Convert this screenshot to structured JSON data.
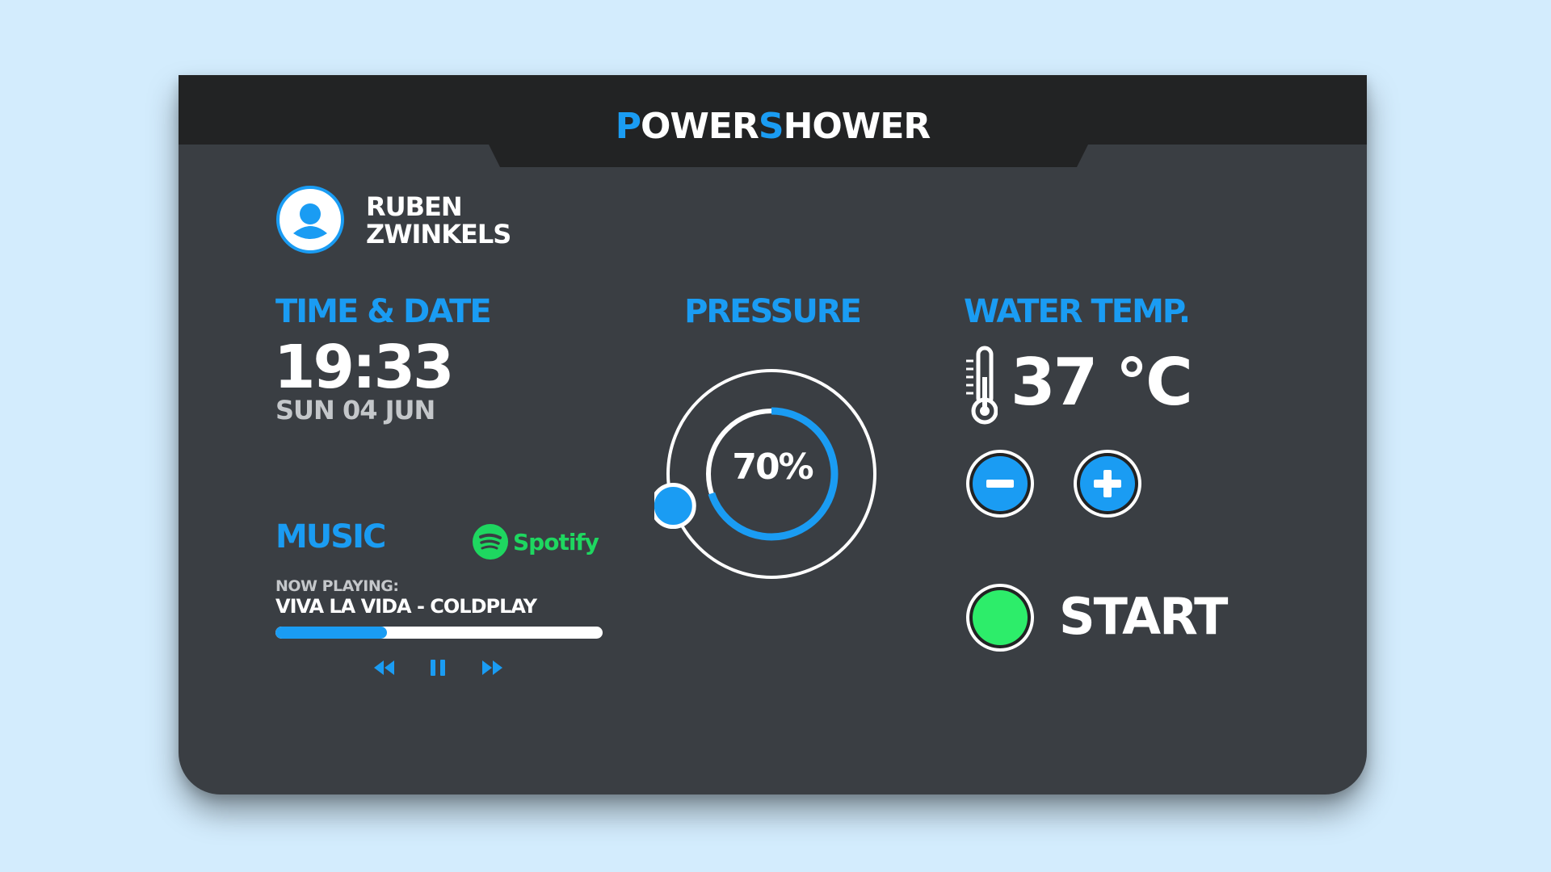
{
  "brand": {
    "first_letter": "P",
    "part1": "OWER",
    "second_letter": "S",
    "part2": "HOWER"
  },
  "user": {
    "first_name": "RUBEN",
    "last_name": "ZWINKELS"
  },
  "time_date": {
    "title": "TIME & DATE",
    "time": "19:33",
    "date": "SUN 04 JUN"
  },
  "music": {
    "title": "MUSIC",
    "service": "Spotify",
    "now_playing_label": "NOW PLAYING:",
    "track": "VIVA LA VIDA - COLDPLAY",
    "progress_fraction": 0.34
  },
  "pressure": {
    "title": "PRESSURE",
    "value_label": "70%",
    "value_fraction": 0.7
  },
  "water_temp": {
    "title": "WATER TEMP.",
    "value": "37 °C"
  },
  "start": {
    "label": "START"
  },
  "colors": {
    "accent": "#1a9cf3",
    "panel": "#3a3e43",
    "header": "#222324",
    "start_green": "#2ded6a",
    "spotify_green": "#1ed760",
    "background": "#d3ecfd"
  },
  "icons": {
    "avatar": "user-avatar-icon",
    "spotify": "spotify-logo-icon",
    "rewind": "rewind-icon",
    "pause": "pause-icon",
    "forward": "fast-forward-icon",
    "thermometer": "thermometer-icon",
    "minus": "minus-icon",
    "plus": "plus-icon"
  }
}
